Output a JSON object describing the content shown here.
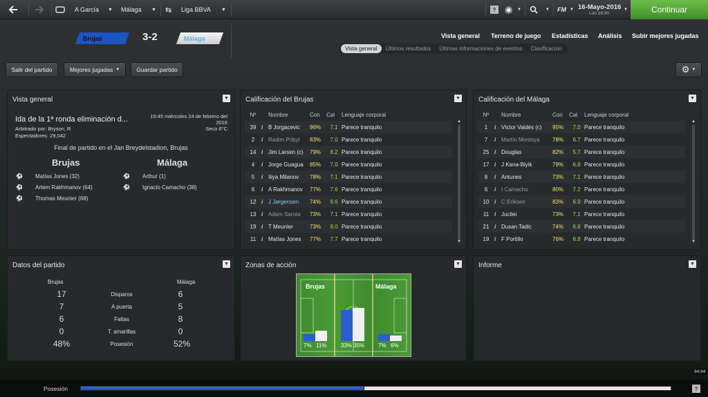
{
  "topbar": {
    "manager": "A García",
    "club": "Málaga",
    "competition": "Liga BBVA",
    "date": "16-Mayo-2016",
    "time": "Lun 16:00",
    "fm_label": "FM",
    "continue_label": "Continuar",
    "help": "?"
  },
  "match": {
    "home": "Brujas",
    "away": "Málaga",
    "score": "3-2",
    "home_color": "#1c54c2",
    "away_color": "#e8e8e8"
  },
  "nav": [
    "Vista general",
    "Terreno de juego",
    "Estadísticas",
    "Análisis",
    "Subir mejores jugadas"
  ],
  "subtabs": [
    "Vista general",
    "Últimos resultados",
    "Últimas informaciones de eventos",
    "Clasificación"
  ],
  "toolbar": {
    "exit": "Salir del partido",
    "highlights": "Mejores jugadas",
    "save": "Guardar partido"
  },
  "overview": {
    "title": "Vista general",
    "competition": "Ida de la 1ª ronda eliminación d...",
    "datetime": "19:45 miércoles 24 de febrero del 2016",
    "weather": "Seco 6°C",
    "referee": "Arbitrado por: Bryson, R",
    "attendance": "Espectadores: 29,042",
    "final": "Final de partido en el Jan Breydelstadion, Brujas",
    "home_scorers": [
      "Matías Jones (32)",
      "Artem Rakhmanov (64)",
      "Thomas Meunier (68)"
    ],
    "away_scorers": [
      "Arthur (1)",
      "Ignacio Camacho (38)"
    ]
  },
  "ratings_headers": {
    "no": "Nº",
    "name": "Nombre",
    "con": "Con",
    "cal": "Cal",
    "lang": "Lenguaje corporal",
    "info": "i"
  },
  "ratings_home": {
    "title": "Calificación del Brujas",
    "rows": [
      {
        "no": "39",
        "name": "B Jorgacevic",
        "con": "96%",
        "cal": "7.1",
        "lang": "Parece tranquilo"
      },
      {
        "no": "2",
        "name": "Radim Pribyl",
        "con": "83%",
        "cal": "7.0",
        "lang": "Parece tranquilo"
      },
      {
        "no": "14",
        "name": "Jim Larsen (c)",
        "con": "79%",
        "cal": "8.2",
        "lang": "Parece tranquilo"
      },
      {
        "no": "4",
        "name": "Jorge Guagua",
        "con": "85%",
        "cal": "7.0",
        "lang": "Parece tranquilo"
      },
      {
        "no": "5",
        "name": "Iliya Milanov",
        "con": "78%",
        "cal": "7.1",
        "lang": "Parece tranquilo"
      },
      {
        "no": "6",
        "name": "A Rakhmanov",
        "con": "77%",
        "cal": "7.6",
        "lang": "Parece tranquilo"
      },
      {
        "no": "12",
        "name": "J Jørgensen",
        "con": "74%",
        "cal": "8.6",
        "lang": "Parece tranquilo"
      },
      {
        "no": "13",
        "name": "Adam Sarota",
        "con": "73%",
        "cal": "7.1",
        "lang": "Parece tranquilo"
      },
      {
        "no": "19",
        "name": "T Meunier",
        "con": "73%",
        "cal": "8.0",
        "lang": "Parece tranquilo"
      },
      {
        "no": "11",
        "name": "Matías Jones",
        "con": "77%",
        "cal": "7.7",
        "lang": "Parece tranquilo"
      }
    ]
  },
  "ratings_away": {
    "title": "Calificación del Málaga",
    "rows": [
      {
        "no": "1",
        "name": "Víctor Valdés (c)",
        "con": "95%",
        "cal": "7.0",
        "lang": "Parece tranquilo"
      },
      {
        "no": "7",
        "name": "Martín Montoya",
        "con": "78%",
        "cal": "6.7",
        "lang": "Parece tranquilo"
      },
      {
        "no": "25",
        "name": "Douglas",
        "con": "82%",
        "cal": "5.7",
        "lang": "Parece tranquilo"
      },
      {
        "no": "17",
        "name": "J Kana-Biyik",
        "con": "79%",
        "cal": "6.8",
        "lang": "Parece tranquilo"
      },
      {
        "no": "8",
        "name": "Antunes",
        "con": "73%",
        "cal": "7.1",
        "lang": "Parece tranquilo"
      },
      {
        "no": "6",
        "name": "I Camacho",
        "con": "80%",
        "cal": "7.2",
        "lang": "Parece tranquilo"
      },
      {
        "no": "10",
        "name": "C Eriksen",
        "con": "83%",
        "cal": "6.9",
        "lang": "Parece tranquilo"
      },
      {
        "no": "11",
        "name": "Jucilei",
        "con": "73%",
        "cal": "7.1",
        "lang": "Parece tranquilo"
      },
      {
        "no": "21",
        "name": "Dusan Tadic",
        "con": "74%",
        "cal": "6.8",
        "lang": "Parece tranquilo"
      },
      {
        "no": "19",
        "name": "F Portillo",
        "con": "76%",
        "cal": "6.8",
        "lang": "Parece tranquilo"
      }
    ]
  },
  "stats": {
    "title": "Datos del partido",
    "home": "Brujas",
    "away": "Málaga",
    "rows": [
      {
        "label": "Disparos",
        "home": "17",
        "away": "6"
      },
      {
        "label": "A puerta",
        "home": "7",
        "away": "5"
      },
      {
        "label": "Faltas",
        "home": "6",
        "away": "8"
      },
      {
        "label": "T. amarillas",
        "home": "0",
        "away": "0"
      },
      {
        "label": "Posesión",
        "home": "48%",
        "away": "52%"
      }
    ]
  },
  "zones": {
    "title": "Zonas de acción",
    "home": "Brujas",
    "away": "Málaga",
    "values": [
      {
        "home": "7%",
        "away": "11%",
        "home_frac": 0.07,
        "away_frac": 0.11
      },
      {
        "home": "33%",
        "away": "35%",
        "home_frac": 0.33,
        "away_frac": 0.35
      },
      {
        "home": "7%",
        "away": "6%",
        "home_frac": 0.07,
        "away_frac": 0.06
      }
    ]
  },
  "report": {
    "title": "Informe"
  },
  "footer": {
    "label": "Posesión",
    "clock": "94:44",
    "home_frac": 0.48,
    "help": "?"
  }
}
